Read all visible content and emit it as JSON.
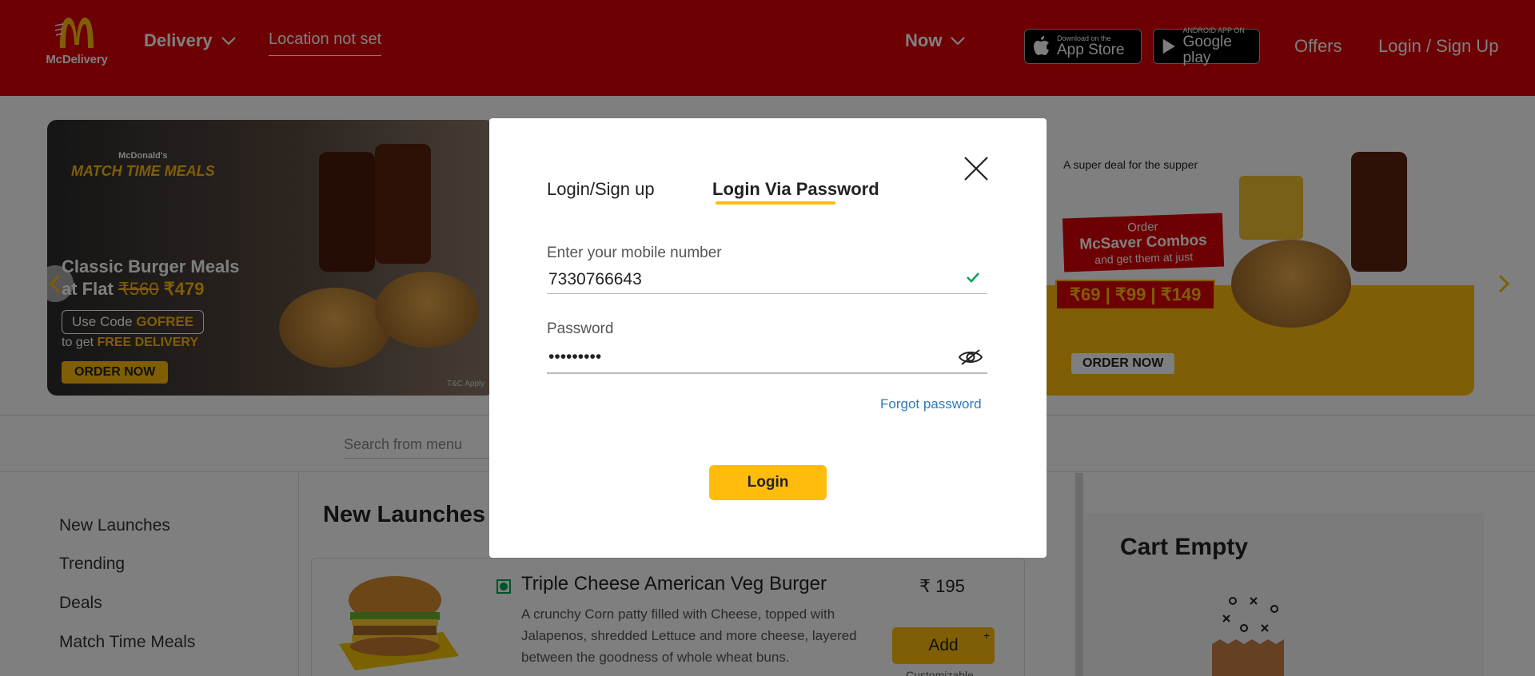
{
  "header": {
    "logo_text": "McDelivery",
    "delivery_label": "Delivery",
    "location_label": "Location not set",
    "now_label": "Now",
    "appstore_small": "Download on the",
    "appstore_big": "App Store",
    "gplay_small": "ANDROID APP ON",
    "gplay_big": "Google play",
    "offers_label": "Offers",
    "login_label": "Login / Sign Up"
  },
  "banner_left": {
    "brand": "McDonald's",
    "campaign": "MATCH TIME MEALS",
    "headline_1": "Classic Burger Meals",
    "headline_2_prefix": "at Flat",
    "old_price": "₹560",
    "new_price": "₹479",
    "code_prefix": "Use Code",
    "code": "GOFREE",
    "delivery_prefix": "to get",
    "delivery_text": "FREE DELIVERY",
    "cta": "ORDER NOW",
    "tc": "T&C Apply"
  },
  "banner_right": {
    "tagline": "A super deal for the supper",
    "order": "Order",
    "title": "McSaver Combos",
    "subtitle": "and get them at just",
    "prices": "₹69 | ₹99 | ₹149",
    "cta": "ORDER NOW"
  },
  "search": {
    "placeholder": "Search from menu"
  },
  "menu": {
    "items": [
      "New Launches",
      "Trending",
      "Deals",
      "Match Time Meals"
    ]
  },
  "products": {
    "section_title": "New Launches",
    "item": {
      "name": "Triple Cheese American Veg Burger",
      "description": "A crunchy Corn patty filled with Cheese, topped with Jalapenos, shredded Lettuce and more cheese, layered between the goodness of whole wheat buns.",
      "price": "₹ 195",
      "add_label": "Add",
      "add_plus": "+",
      "customizable": "Customizable"
    }
  },
  "cart": {
    "title": "Cart Empty"
  },
  "modal": {
    "tab_1": "Login/Sign up",
    "tab_2": "Login Via Password",
    "mobile_label": "Enter your mobile number",
    "mobile_value": "7330766643",
    "password_label": "Password",
    "password_value": "•••••••••",
    "forgot_label": "Forgot password",
    "login_button": "Login"
  },
  "colors": {
    "brand_red": "#db0007",
    "brand_yellow": "#ffbc0d",
    "valid_green": "#00a651",
    "link_blue": "#2a7bbf"
  }
}
